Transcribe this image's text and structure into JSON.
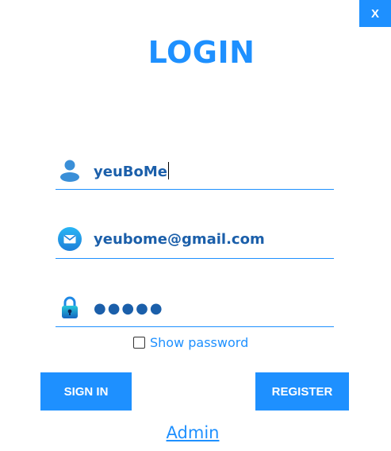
{
  "window": {
    "close_label": "X"
  },
  "title": "LOGIN",
  "fields": {
    "username": {
      "value": "yeuBoMe",
      "icon": "user-icon"
    },
    "email": {
      "value": "yeubome@gmail.com",
      "icon": "email-icon"
    },
    "password": {
      "value": "●●●●●",
      "icon": "lock-icon"
    }
  },
  "show_password": {
    "label": "Show password",
    "checked": false
  },
  "buttons": {
    "sign_in": "SIGN IN",
    "register": "REGISTER"
  },
  "admin_link": "Admin",
  "colors": {
    "accent": "#1e90ff",
    "input_text": "#1b5faa",
    "background": "#ffffff"
  }
}
